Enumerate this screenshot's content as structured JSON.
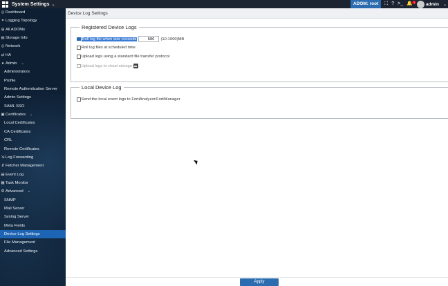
{
  "topbar": {
    "title": "System Settings",
    "caret": "⌄",
    "adom_label": "ADOM: root",
    "notification_count": "1",
    "user": "admin",
    "user_caret": "⌄",
    "icons": [
      "grid-icon",
      "expand-icon",
      "help-icon",
      "terminal-icon",
      "bell-icon",
      "avatar"
    ]
  },
  "sidebar": {
    "items": [
      {
        "label": "Dashboard",
        "icon": "◎"
      },
      {
        "label": "Logging Topology",
        "icon": "⚭"
      },
      {
        "label": "All ADOMs",
        "icon": "⊞"
      },
      {
        "label": "Storage Info",
        "icon": "▤"
      },
      {
        "label": "Network",
        "icon": "◎"
      },
      {
        "label": "HA",
        "icon": "⇄"
      },
      {
        "label": "Admin",
        "icon": "●",
        "chevron": "⌄"
      },
      {
        "label": "Administrators",
        "sub": true
      },
      {
        "label": "Profile",
        "sub": true
      },
      {
        "label": "Remote Authentication Server",
        "sub": true
      },
      {
        "label": "Admin Settings",
        "sub": true
      },
      {
        "label": "SAML SSO",
        "sub": true
      },
      {
        "label": "Certificates",
        "icon": "▣",
        "chevron": "⌄"
      },
      {
        "label": "Local Certificates",
        "sub": true
      },
      {
        "label": "CA Certificates",
        "sub": true
      },
      {
        "label": "CRL",
        "sub": true
      },
      {
        "label": "Remote Certificates",
        "sub": true
      },
      {
        "label": "Log Forwarding",
        "icon": "⇲"
      },
      {
        "label": "Fetcher Management",
        "icon": "⇵"
      },
      {
        "label": "Event Log",
        "icon": "▤"
      },
      {
        "label": "Task Monitor",
        "icon": "▦"
      },
      {
        "label": "Advanced",
        "icon": "⚙",
        "chevron": "⌄"
      },
      {
        "label": "SNMP",
        "sub": true
      },
      {
        "label": "Mail Server",
        "sub": true
      },
      {
        "label": "Syslog Server",
        "sub": true
      },
      {
        "label": "Meta Fields",
        "sub": true
      },
      {
        "label": "Device Log Settings",
        "sub": true,
        "active": true
      },
      {
        "label": "File Management",
        "sub": true
      },
      {
        "label": "Advanced Settings",
        "sub": true
      }
    ]
  },
  "page": {
    "title": "Device Log Settings",
    "registered": {
      "title": "Registered Device Logs",
      "roll_size_label": "Roll log file when size exceeds",
      "roll_size_value": "500",
      "roll_size_unit": "(10-1000)MB",
      "roll_schedule_label": "Roll log files at scheduled time",
      "upload_label": "Upload logs using a standard file transfer protocol",
      "cloud_label": "Upload logs to cloud storage"
    },
    "local": {
      "title": "Local Device Log",
      "send_label": "Send the local event logs to FortiAnalyzer/FortiManager"
    },
    "apply_label": "Apply"
  },
  "colors": {
    "sidebar_bg": "#0e1f33",
    "topbar_bg": "#1b2430",
    "accent": "#2b6cb0",
    "active_item": "#1e64b4",
    "badge": "#d0021b"
  }
}
